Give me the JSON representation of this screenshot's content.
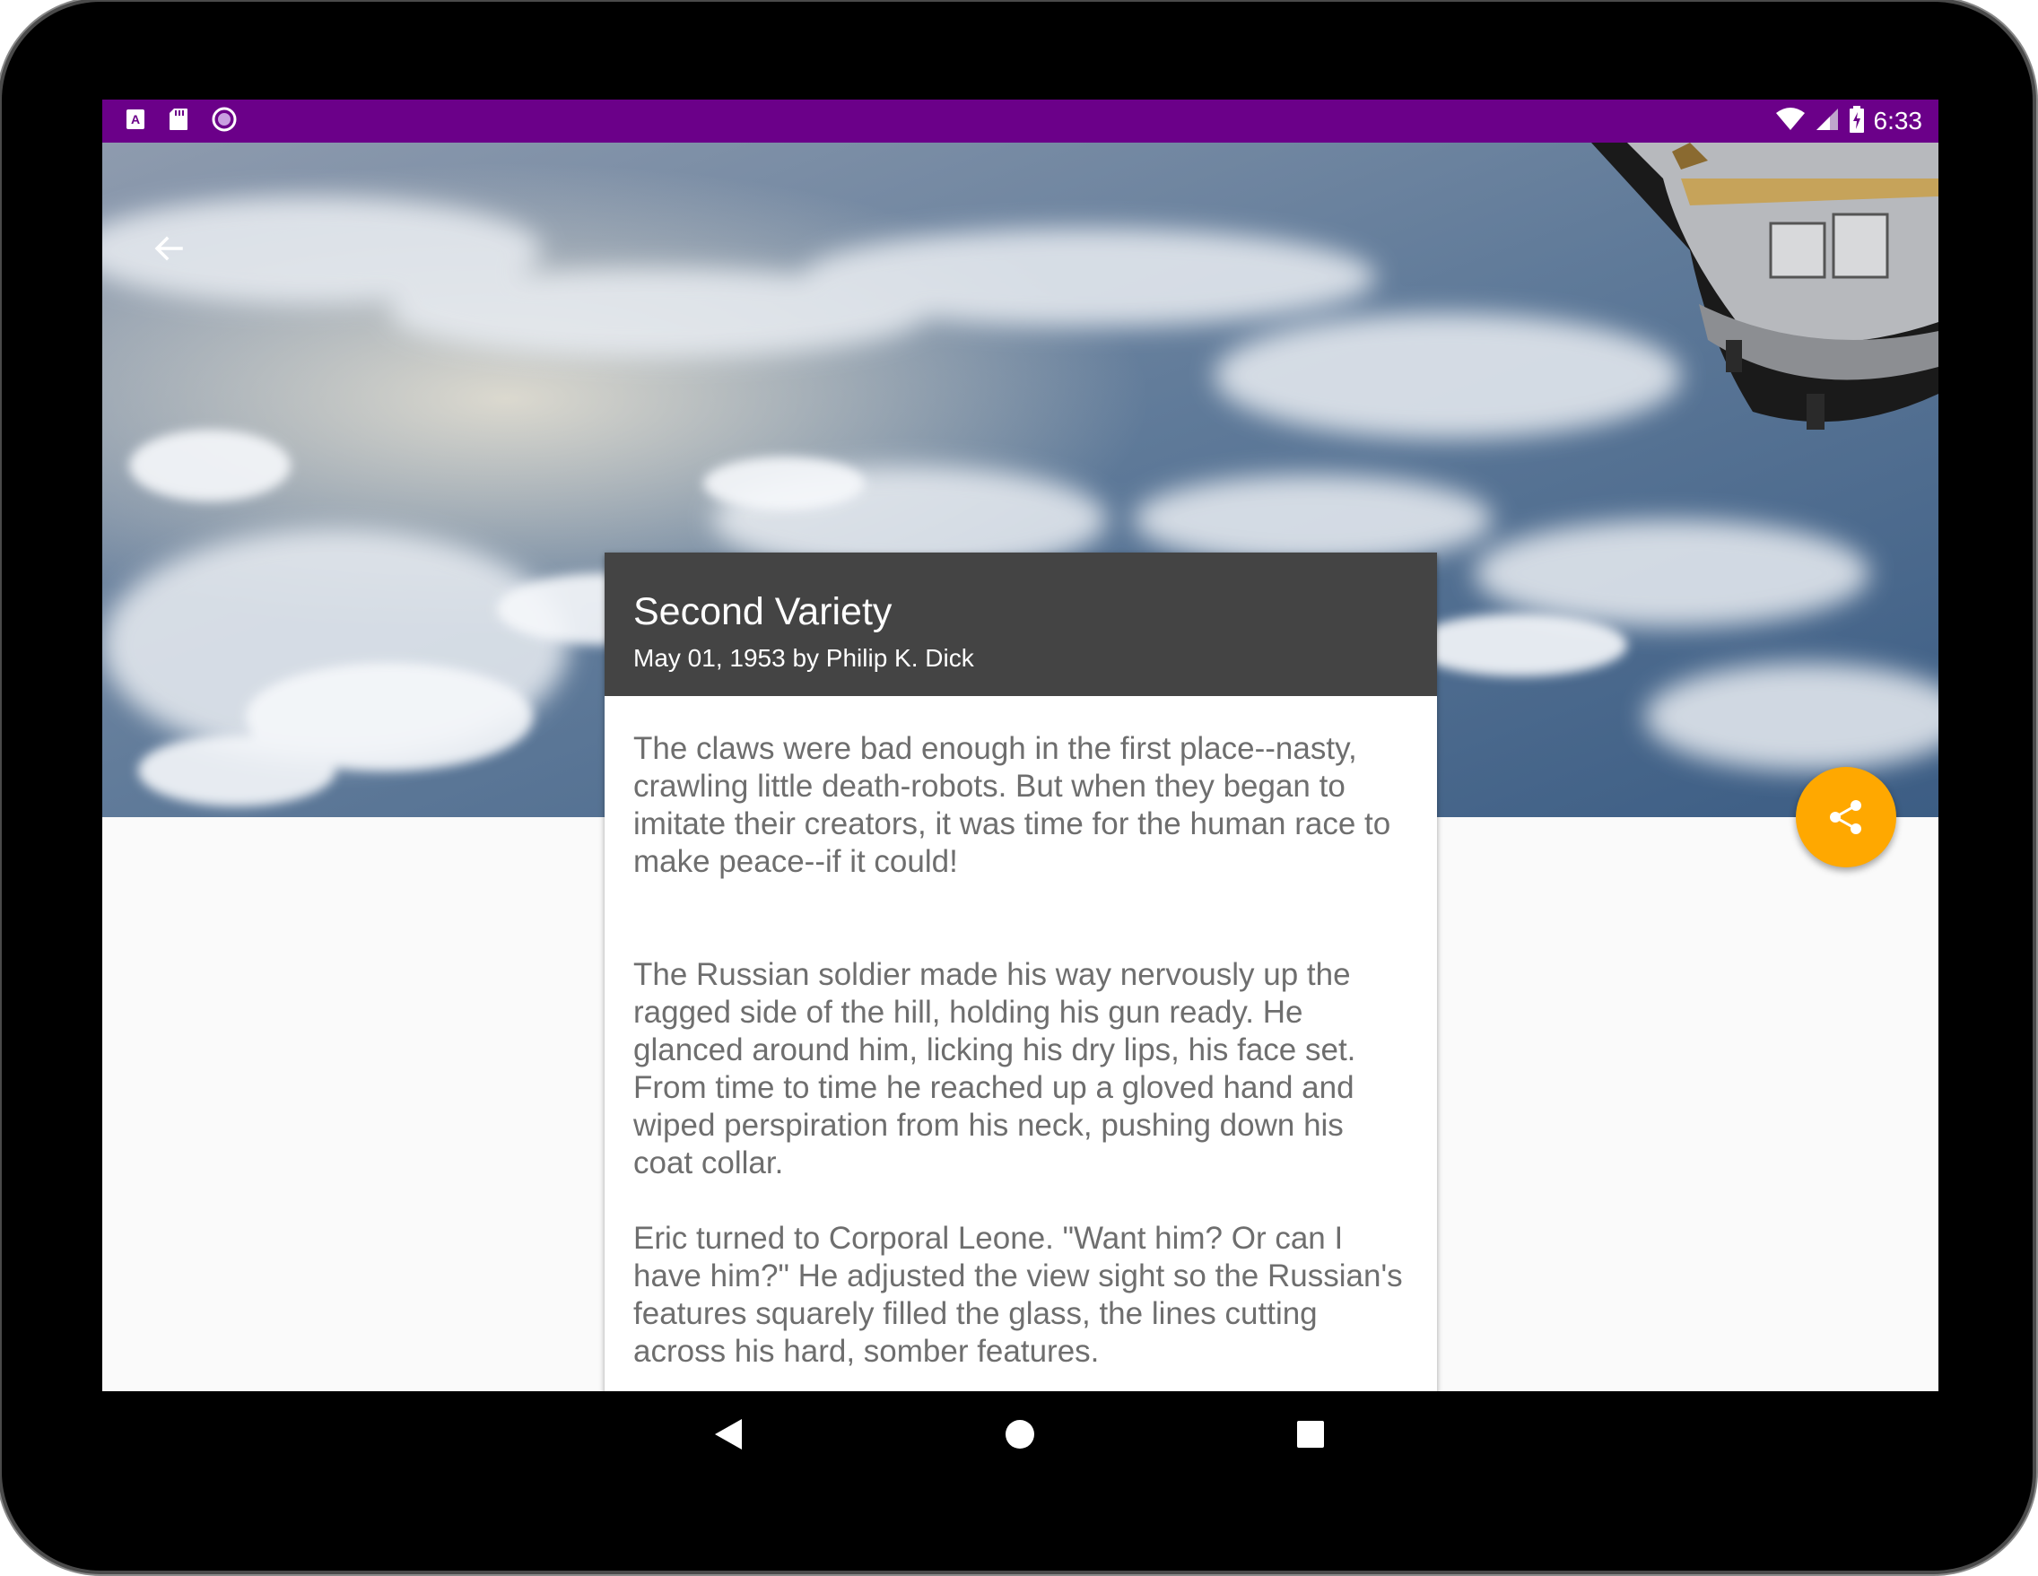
{
  "status_bar": {
    "time": "6:33",
    "left_icons": [
      "a-notification-icon",
      "sd-card-icon",
      "circle-notification-icon"
    ],
    "right_icons": [
      "wifi-icon",
      "signal-icon",
      "battery-charging-icon"
    ],
    "color": "#6b0089"
  },
  "hero": {
    "image_description_icon": "earth-from-space-image"
  },
  "toolbar": {
    "back_icon": "arrow-back-icon"
  },
  "article": {
    "title": "Second Variety",
    "subtitle": "May 01, 1953 by Philip K. Dick",
    "paragraphs": [
      "The claws were bad enough in the first place--nasty, crawling little death-robots. But when they began to imitate their creators, it was time for the human race to make peace--if it could!",
      "The Russian soldier made his way nervously up the ragged side of the hill, holding his gun ready. He glanced around him, licking his dry lips, his face set. From time to time he reached up a gloved hand and wiped perspiration from his neck, pushing down his coat collar.",
      "Eric turned to Corporal Leone. \"Want him? Or can I have him?\" He adjusted the view sight so the Russian's features squarely filled the glass, the lines cutting across his hard, somber features."
    ],
    "header_color": "#444444"
  },
  "fab": {
    "icon": "share-icon",
    "color": "#ffa800"
  },
  "nav_bar": {
    "buttons": [
      "back-triangle-icon",
      "home-circle-icon",
      "recents-square-icon"
    ]
  }
}
